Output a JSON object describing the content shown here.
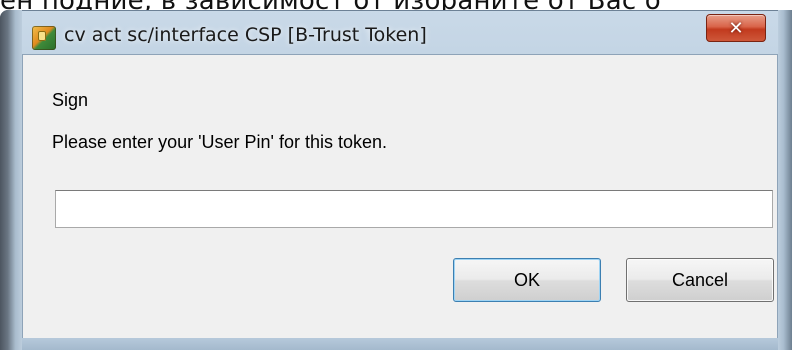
{
  "background": {
    "text": "ен подние, в зависимост от избраните от Вас о"
  },
  "window": {
    "title": "cv act sc/interface CSP [B-Trust Token]",
    "icon": "application-icon",
    "close_label": "✕"
  },
  "dialog": {
    "heading": "Sign",
    "prompt": "Please enter your 'User Pin' for this token.",
    "pin_input": {
      "value": "",
      "placeholder": ""
    },
    "ok_label": "OK",
    "cancel_label": "Cancel"
  },
  "colors": {
    "frame": "#b7cadc",
    "client": "#f0f0f0",
    "close_button": "#c23a1e",
    "default_button_border": "#3c7fb1"
  }
}
